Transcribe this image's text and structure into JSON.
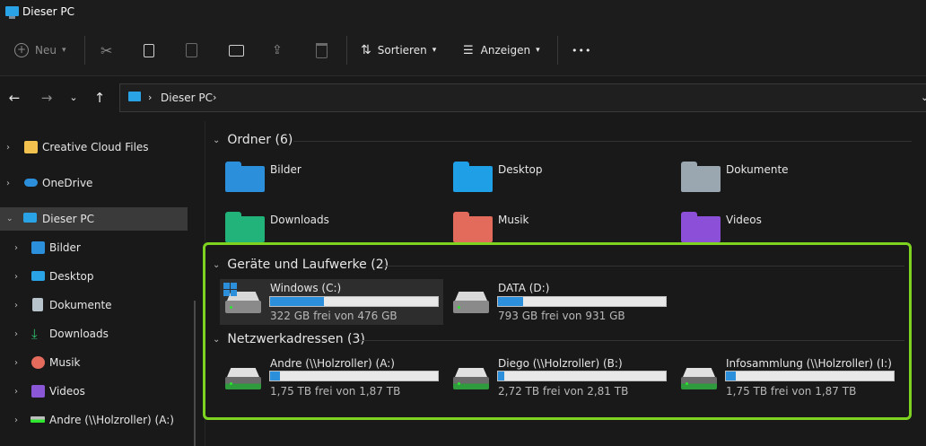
{
  "window": {
    "title": "Dieser PC"
  },
  "toolbar": {
    "new_label": "Neu",
    "sort_label": "Sortieren",
    "view_label": "Anzeigen",
    "more_label": "•••"
  },
  "nav": {
    "address": [
      "Dieser PC"
    ]
  },
  "sidebar": {
    "items": [
      {
        "label": "Creative Cloud Files",
        "icon": "creative-cloud-icon",
        "color": "#f2c14e"
      },
      {
        "label": "OneDrive",
        "icon": "cloud-icon",
        "color": "#2b8fdc"
      },
      {
        "label": "Dieser PC",
        "icon": "computer-icon",
        "color": "#2aa3e6"
      },
      {
        "label": "Bilder",
        "icon": "pictures-icon",
        "color": "#2b8fdc"
      },
      {
        "label": "Desktop",
        "icon": "desktop-icon",
        "color": "#2aa3e6"
      },
      {
        "label": "Dokumente",
        "icon": "documents-icon",
        "color": "#b8c4cc"
      },
      {
        "label": "Downloads",
        "icon": "download-icon",
        "color": "#2fbf71"
      },
      {
        "label": "Musik",
        "icon": "music-icon",
        "color": "#e56b5d"
      },
      {
        "label": "Videos",
        "icon": "videos-icon",
        "color": "#8a57d6"
      },
      {
        "label": "Andre (\\\\Holzroller) (A:)",
        "icon": "network-drive-icon",
        "color": "#2ee62e"
      }
    ]
  },
  "groups": {
    "folders_title": "Ordner (6)",
    "drives_title": "Geräte und Laufwerke (2)",
    "network_title": "Netzwerkadressen (3)"
  },
  "folders": [
    {
      "label": "Bilder",
      "icon": "pictures-folder-icon",
      "color": "#2b8fdc"
    },
    {
      "label": "Desktop",
      "icon": "desktop-folder-icon",
      "color": "#1f9fe6"
    },
    {
      "label": "Dokumente",
      "icon": "documents-folder-icon",
      "color": "#9aa7b1"
    },
    {
      "label": "Downloads",
      "icon": "downloads-folder-icon",
      "color": "#22b37a"
    },
    {
      "label": "Musik",
      "icon": "music-folder-icon",
      "color": "#e26b5c"
    },
    {
      "label": "Videos",
      "icon": "videos-folder-icon",
      "color": "#8c4fd8"
    }
  ],
  "drives": [
    {
      "name": "Windows (C:)",
      "free": "322 GB frei von 476 GB",
      "used_fraction": 0.32
    },
    {
      "name": "DATA (D:)",
      "free": "793 GB frei von 931 GB",
      "used_fraction": 0.15
    }
  ],
  "network": [
    {
      "name": "Andre (\\\\Holzroller) (A:)",
      "free": "1,75 TB frei von 1,87 TB",
      "used_fraction": 0.06
    },
    {
      "name": "Diego (\\\\Holzroller) (B:)",
      "free": "2,72 TB frei von 2,81 TB",
      "used_fraction": 0.04
    },
    {
      "name": "Infosammlung (\\\\Holzroller) (I:)",
      "free": "1,75 TB frei von 1,87 TB",
      "used_fraction": 0.06
    }
  ],
  "colors": {
    "accent": "#2b8fdc",
    "highlight": "#7ed321"
  }
}
